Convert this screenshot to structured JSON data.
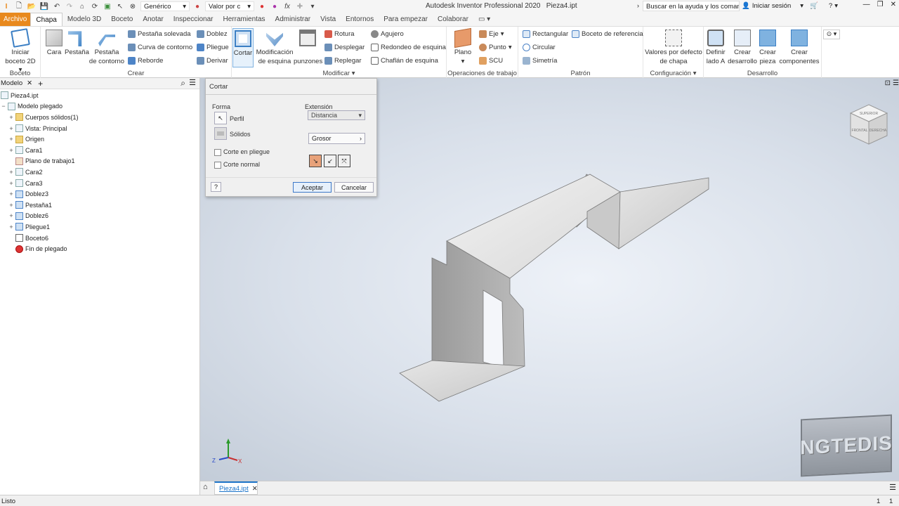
{
  "title": {
    "app": "Autodesk Inventor Professional 2020",
    "doc": "Pieza4.ipt"
  },
  "quick_access": {
    "material": "Genérico",
    "appearance": "Valor por c"
  },
  "help": {
    "search": "Buscar en la ayuda y los comandos",
    "signin": "Iniciar sesión"
  },
  "tabs": [
    "Archivo",
    "Chapa",
    "Modelo 3D",
    "Boceto",
    "Anotar",
    "Inspeccionar",
    "Herramientas",
    "Administrar",
    "Vista",
    "Entornos",
    "Para empezar",
    "Colaborar"
  ],
  "ribbon": {
    "boceto": {
      "label": "Boceto",
      "btn1": "Iniciar",
      "btn2": "boceto 2D"
    },
    "crear": {
      "label": "Crear",
      "cara": "Cara",
      "pestana": "Pestaña",
      "pestcont1": "Pestaña",
      "pestcont2": "de contorno",
      "s1": "Pestaña solevada",
      "s2": "Curva de contorno",
      "s3": "Reborde",
      "s4": "Doblez",
      "s5": "Pliegue",
      "s6": "Derivar"
    },
    "modificar": {
      "label": "Modificar",
      "cortar": "Cortar",
      "mod1": "Modificación",
      "mod2": "de esquina",
      "punzones": "punzones",
      "s1": "Rotura",
      "s2": "Desplegar",
      "s3": "Replegar",
      "s4": "Agujero",
      "s5": "Redondeo de esquina",
      "s6": "Chaflán de esquina"
    },
    "trabajo": {
      "label": "Operaciones de trabajo",
      "plano": "Plano",
      "s1": "Eje",
      "s2": "Punto",
      "s3": "SCU"
    },
    "patron": {
      "label": "Patrón",
      "s1": "Rectangular",
      "s2": "Circular",
      "s3": "Simetría",
      "s4": "Boceto de referencia"
    },
    "config": {
      "label": "Configuración",
      "b1": "Valores por defecto",
      "b2": "de chapa"
    },
    "desarrollo": {
      "label": "Desarrollo",
      "a1": "Definir",
      "a2": "lado A",
      "b1": "Crear",
      "b2": "desarrollo",
      "c1": "Crear",
      "c2": "pieza",
      "d1": "Crear",
      "d2": "componentes"
    }
  },
  "browser": {
    "tab": "Modelo",
    "root": "Pieza4.ipt",
    "items": [
      "Modelo plegado",
      "Cuerpos sólidos(1)",
      "Vista: Principal",
      "Origen",
      "Cara1",
      "Plano de trabajo1",
      "Cara2",
      "Cara3",
      "Doblez3",
      "Pestaña1",
      "Doblez6",
      "Pliegue1",
      "Boceto6",
      "Fin de plegado"
    ]
  },
  "dialog": {
    "title": "Cortar",
    "forma": "Forma",
    "perfil": "Perfil",
    "solidos": "Sólidos",
    "corte_pliegue": "Corte en pliegue",
    "corte_normal": "Corte normal",
    "extension": "Extensión",
    "distancia": "Distancia",
    "grosor": "Grosor",
    "aceptar": "Aceptar",
    "cancelar": "Cancelar"
  },
  "viewcube": {
    "top": "SUPERIOR",
    "front": "FRONTAL",
    "right": "DERECHA"
  },
  "watermark": "NGTEDIS",
  "doc_tab": "Pieza4.ipt",
  "status": {
    "left": "Listo",
    "n1": "1",
    "n2": "1"
  },
  "colors": {
    "file_tab": "#e8891e",
    "accent": "#1a73c9"
  }
}
